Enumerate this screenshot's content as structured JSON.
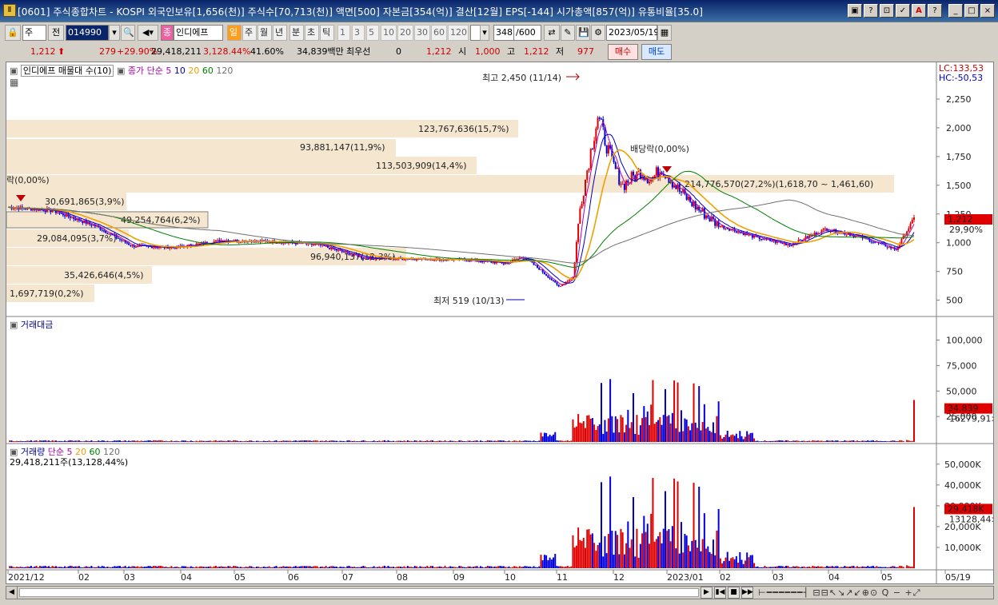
{
  "window": {
    "title": "[0601] 주식종합차트 - KOSPI 외국인보유[1,656(천)] 주식수[70,713(천)] 액면[500] 자본금[354(억)] 결산[12월] EPS[-144] 시가총액[857(억)] 유통비율[35.0]",
    "buttons": [
      "▣",
      "?",
      "⊡",
      "✓",
      "A",
      "?"
    ],
    "min_label": "_",
    "max_label": "□",
    "close_label": "×"
  },
  "toolbar": {
    "market": "주",
    "market_sel": "전",
    "code": "014990",
    "stock_name": "인디에프",
    "periods": [
      "일",
      "주",
      "월",
      "년",
      "분",
      "초",
      "틱"
    ],
    "active_period": "일",
    "nums": [
      "1",
      "3",
      "5",
      "10",
      "20",
      "30",
      "60",
      "120"
    ],
    "count": "348",
    "count_max": "/600",
    "date": "2023/05/19"
  },
  "quote": {
    "price": "1,212",
    "change": "279",
    "rate": "+29.90%",
    "volume": "29,418,211",
    "vol_ratio": "3,128.44%",
    "turnover": "41.60%",
    "amount": "34,839백만",
    "best": "최우선",
    "zero": "0",
    "ask": "1,212",
    "open_label": "시",
    "open": "1,000",
    "high_label": "고",
    "high": "1,212",
    "low_label": "저",
    "low": "977",
    "buy_label": "매수",
    "sell_label": "매도"
  },
  "price_pane": {
    "legend_name": "인디에프 매물대 수(10)",
    "ma_label": "종가 단순",
    "ma_periods": [
      "5",
      "10",
      "20",
      "60",
      "120"
    ],
    "lc_label": "LC:133,53",
    "hc_label": "HC:-50,53",
    "last_price": "1,212",
    "last_rate": "29,90%",
    "high_note": "최고 2,450 (11/14)",
    "low_note": "최저 519 (10/13)",
    "dividend_note": "배당락(0,00%)",
    "dividend_note2": "락(0,00%)",
    "volume_profile": [
      {
        "label": "123,767,636(15,7%)"
      },
      {
        "label": "93,881,147(11,9%)"
      },
      {
        "label": "113,503,909(14,4%)"
      },
      {
        "label": "214,776,570(27,2%)(1,618,70 ~ 1,461,60)"
      },
      {
        "label": "30,691,865(3,9%)"
      },
      {
        "label": "49,254,764(6,2%)"
      },
      {
        "label": "29,084,095(3,7%)"
      },
      {
        "label": "96,940,137(12,3%)"
      },
      {
        "label": "35,426,646(4,5%)"
      },
      {
        "label": "1,697,719(0,2%)"
      }
    ],
    "y_ticks": [
      "2,250",
      "2,000",
      "1,750",
      "1,500",
      "1,250",
      "1,000",
      "750",
      "500"
    ]
  },
  "amount_pane": {
    "legend": "거래대금",
    "y_ticks": [
      "100,000",
      "75,000",
      "50,000",
      "25,000"
    ],
    "last_value": "34,839",
    "last_sub": "16279,91>"
  },
  "volume_pane": {
    "legend": "거래량",
    "ma_label": "단순",
    "ma_periods": [
      "5",
      "20",
      "60",
      "120"
    ],
    "summary": "29,418,211주(13,128,44%)",
    "y_ticks": [
      "50,000K",
      "40,000K",
      "30,000K",
      "20,000K",
      "10,000K"
    ],
    "last_value": "29,418K",
    "last_sub": "13128,44>"
  },
  "x_axis": [
    "2021/12",
    "02",
    "03",
    "04",
    "05",
    "06",
    "07",
    "08",
    "09",
    "10",
    "11",
    "12",
    "2023/01",
    "02",
    "03",
    "04",
    "05",
    "05/19"
  ],
  "colors": {
    "up": "#e00000",
    "down": "#0000e0",
    "ma5": "#b000b0",
    "ma10": "#0000c0",
    "ma20": "#f0a000",
    "ma60": "#008000",
    "ma120": "#707070",
    "profile": "#f5e6d0"
  }
}
